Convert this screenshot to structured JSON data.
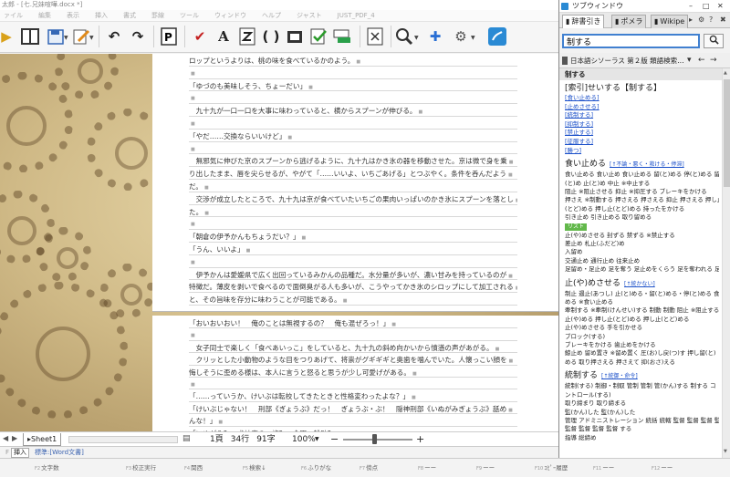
{
  "editor": {
    "title": "太郎 - [七.兄妹喧嘩.docx *]",
    "menu": [
      "ァイル",
      "編集",
      "表示",
      "挿入",
      "書式",
      "罫線",
      "ツール",
      "ウィンドウ",
      "ヘルプ",
      "ジャスト",
      "JUST_PDF_4"
    ],
    "toolbar_icons": [
      "folder-icon",
      "panel-icon",
      "save-icon",
      "edit-icon",
      "undo-icon",
      "redo-icon",
      "pdf-icon",
      "check-icon",
      "font-icon",
      "kanji-icon",
      "paren-icon",
      "chart-icon",
      "verify-icon",
      "ruler-icon",
      "close-doc-icon",
      "search-icon",
      "addin-icon",
      "gear-icon",
      "dictionary-icon"
    ]
  },
  "page1": {
    "lines": [
      "ロップというよりは、桃の味を食べているかのよう。",
      "",
      "「ゆづのも美味しそう、ちょーだい」",
      "",
      "　九十九が一口一口を大事に味わっていると、横からスプーンが伸びる。",
      "",
      "「やだ……交換ならいいけど」",
      "",
      "　無邪気に伸びた京のスプーンから逃げるように、九十九はかき氷の器を移動させた。京は微で身を乗",
      "り出したまま、唇を尖らせるが、やがて「……いいよ、いちごあげる」とつぶやく。条件を呑んだよう",
      "だ。",
      "　交渉が成立したところで、九十九は京が食べていたいちごの果肉いっぱいのかき氷にスプーンを落とし",
      "た。",
      "",
      "「朝倉の伊予かんもちょうだい？」",
      "「うん、いいよ」",
      "",
      "　伊予かんは愛媛県で広く出回っているみかんの品種だ。水分量が多いが、濃い甘みを持っているのが",
      "特徴だ。薄皮を剥いで食べるので面倒臭がる人も多いが、こうやってかき氷のシロップにして加工される",
      "と、その旨味を存分に味わうことが可能である。"
    ]
  },
  "page2": {
    "lines": [
      "「おいおいおい！　俺のことは無視するの？　俺も混ぜろっ！」",
      "",
      "　女子同士で楽しく「食べあいっこ」をしていると、九十九の斜め向かいから憤懣の声があがる。",
      "　クリッとした小動物のような目をつりあげて、将崇がグギギギと奥歯を噛んでいた。人懐っこい顔を",
      "悔しそうに歪める様は、本人に言うと怒ると思うが少し可愛げがある。",
      "",
      "「……っていうか、けいぶは転校してきたときと性格変わったよな？」",
      "「けいぶじゃない！　刑部《ぎょうぶ》だっ！　ぎょうぶ・ぶ！　隠神刑部《いぬがみぎょうぶ》舐め",
      "んな！」",
      "「いぬがみ？　犬神家の一族？　金田一耕助？」"
    ]
  },
  "sheet_tab": "Sheet1",
  "status": {
    "page": "1頁",
    "line": "34行",
    "char": "91字",
    "zoom": "100%",
    "zoom_level": 0.42
  },
  "modebar": {
    "f_label": "F",
    "mode": "挿入",
    "ime": "標準:[Word文書]"
  },
  "fkeys": [
    {
      "key": "F2",
      "label": "文字数"
    },
    {
      "key": "F3",
      "label": "校正実行"
    },
    {
      "key": "F4",
      "label": "関西"
    },
    {
      "key": "F5",
      "label": "検索↓"
    },
    {
      "key": "F6",
      "label": "ふりがな"
    },
    {
      "key": "F7",
      "label": "傍点"
    },
    {
      "key": "F8",
      "label": "ーー"
    },
    {
      "key": "F9",
      "label": "ーー"
    },
    {
      "key": "F10",
      "label": "ｺﾋﾟｰ履歴"
    },
    {
      "key": "F11",
      "label": "ーー"
    },
    {
      "key": "F12",
      "label": "ーー"
    }
  ],
  "dict": {
    "title": "ツブウィンドウ",
    "tabs": [
      "辞書引き",
      "ポメラ",
      "Wikipe"
    ],
    "search_value": "制する",
    "search_button": "Q",
    "book": "日本語シソーラス 第２版 類語検索…",
    "head": "制する",
    "entry_word": "[索引]せいする【制する】",
    "entry_links": [
      "[食い止める]",
      "[止めさせる]",
      "[統制する]",
      "[抑制する]",
      "[禁止する]",
      "[征服する]",
      "[勝つ]"
    ],
    "sections": [
      {
        "word": "食い止める",
        "sub": "[↑不論・悪く・救ける・停滞]",
        "lines": [
          "食い止める 食い止め 食い止める 留(と)める 停(と)める 留",
          "(と)め 止(と)め 中止 ※中止する",
          "阻止 ※阻止させる 抑止 ※抑圧する ブレーキをかける",
          "押さえ ※制動する 押さえる 押さえる 抑止 押さえる 押し止",
          "(とど)める 押し止(とど)める 持ったをかける",
          "引き止め 引き止める 取り留める"
        ],
        "badge": "リスト",
        "lines2": [
          "止(や)めさせる 封ずる 禁ずる ※禁止する",
          "差止め 札止(ふだど)め",
          "入留め",
          "交通止め 通行止め 往来止め",
          "足留め・足止め 足を奪う 足止めをくらう 足を奪われる 足を奪"
        ]
      },
      {
        "word": "止(や)めさせる",
        "sub": "[↑統かない]",
        "lines": [
          "制止 遏止(あつし) 止(と)める・留(と)める・停(と)める 食い止",
          "める ※食い止める",
          "牽制する ※牽制(けんせい)する 制動 制動 阻止 ※阻止する 押さ",
          "止(や)める 押し止(とど)める 押し止(とど)める",
          "止(や)めさせる 手を引かせる",
          "ブロック(する)",
          "ブレーキをかける 歯止めをかける",
          "鯨止め 留め置き ※留め置く 圧(お)し戻(つ)す 押し留(と)",
          "める 取り押さえる 押さえて 抑(おさ)える"
        ]
      },
      {
        "word": "統制する",
        "sub": "[↑統御・命令]",
        "lines": [
          "統制(する) 制御・制馭 管制 管制 管(かん)する 制する コ",
          "ントロール(する)",
          "取り締まり 取り締まる",
          "監(かん)した 監(かん)した",
          "管理 アドミニストレーション 統括 統轄 監督 監督 監督 監督",
          "監督 監督 監督 監督 する",
          "指導 総締め"
        ]
      }
    ]
  }
}
